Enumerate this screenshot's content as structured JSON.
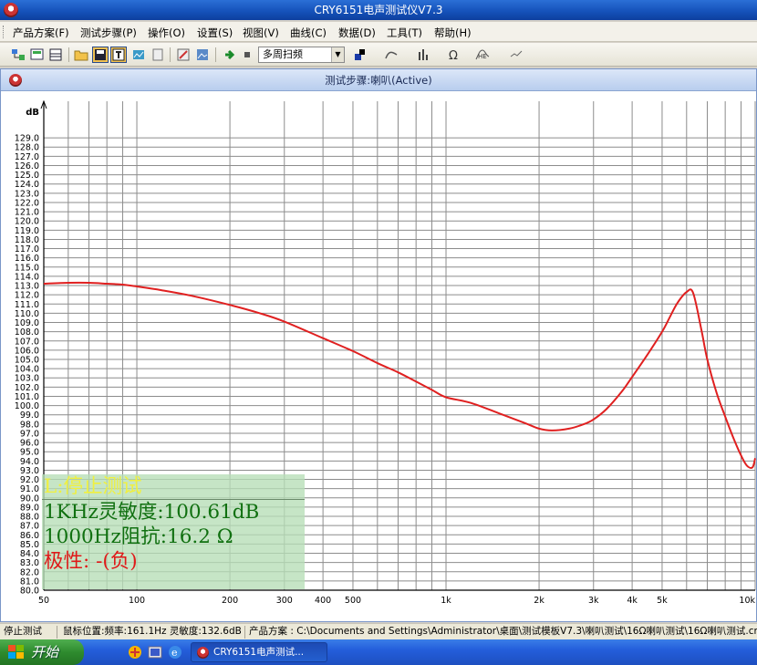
{
  "window": {
    "title": "CRY6151电声测试仪V7.3"
  },
  "menu": [
    "产品方案(F)",
    "测试步骤(P)",
    "操作(O)",
    "设置(S)",
    "视图(V)",
    "曲线(C)",
    "数据(D)",
    "工具(T)",
    "帮助(H)"
  ],
  "toolbar": {
    "sweep_mode": "多周扫频"
  },
  "child_window": {
    "title": "测试步骤:喇叭(Active)"
  },
  "status_bar": {
    "state": "停止测试",
    "cursor": "鼠标位置:频率:161.1Hz 灵敏度:132.6dB",
    "product": "产品方案 : C:\\Documents and Settings\\Administrator\\桌面\\测试模板V7.3\\喇叭测试\\16Ω喇叭测试\\16Ω喇叭测试.cry"
  },
  "taskbar": {
    "start_label": "开始",
    "task_label": "CRY6151电声测试..."
  },
  "overlay": {
    "status": "L:停止测试",
    "sensitivity": "1KHz灵敏度:100.61dB",
    "impedance": "1000Hz阻抗:16.2 Ω",
    "polarity": "极性: -(负)"
  },
  "colors": {
    "curve": "#e02020",
    "status_text": "#f0f040",
    "value_text": "#107010",
    "polarity_text": "#e01818",
    "grid": "#8c8c8c"
  },
  "chart_data": {
    "type": "line",
    "title": "",
    "ylabel": "dB",
    "xlabel": "",
    "x_scale": "log",
    "xlim": [
      50,
      10000
    ],
    "ylim": [
      80,
      130
    ],
    "x_ticks": [
      50,
      100,
      200,
      300,
      400,
      500,
      1000,
      2000,
      3000,
      4000,
      5000,
      10000
    ],
    "x_tick_labels": [
      "50",
      "100",
      "200",
      "300",
      "400",
      "500",
      "1k",
      "2k",
      "3k",
      "4k",
      "5k",
      "10k"
    ],
    "y_ticks": [
      80.0,
      81.0,
      82.0,
      83.0,
      84.0,
      85.0,
      86.0,
      87.0,
      88.0,
      89.0,
      90.0,
      91.0,
      92.0,
      93.0,
      94.0,
      95.0,
      96.0,
      97.0,
      98.0,
      99.0,
      100.0,
      101.0,
      102.0,
      103.0,
      104.0,
      105.0,
      106.0,
      107.0,
      108.0,
      109.0,
      110.0,
      111.0,
      112.0,
      113.0,
      114.0,
      115.0,
      116.0,
      117.0,
      118.0,
      119.0,
      120.0,
      121.0,
      122.0,
      123.0,
      124.0,
      125.0,
      126.0,
      127.0,
      128.0,
      129.0
    ],
    "grid": true,
    "series": [
      {
        "x": [
          50,
          60,
          70,
          80,
          90,
          100,
          120,
          150,
          200,
          250,
          300,
          400,
          500,
          600,
          700,
          800,
          900,
          1000,
          1200,
          1500,
          1800,
          2000,
          2200,
          2500,
          2800,
          3000,
          3300,
          3700,
          4000,
          4500,
          5000,
          5300,
          5600,
          6000,
          6300,
          6700,
          7000,
          7500,
          8000,
          8500,
          9000,
          9400,
          9800,
          10000
        ],
        "y": [
          113.2,
          113.3,
          113.3,
          113.2,
          113.1,
          112.9,
          112.5,
          111.9,
          110.9,
          110.0,
          109.1,
          107.3,
          105.9,
          104.6,
          103.6,
          102.6,
          101.7,
          100.9,
          100.3,
          99.1,
          98.1,
          97.5,
          97.3,
          97.5,
          98.0,
          98.5,
          99.6,
          101.5,
          103.1,
          105.6,
          108.0,
          109.6,
          111.1,
          112.3,
          112.2,
          108.2,
          105.0,
          101.4,
          98.8,
          96.5,
          94.6,
          93.5,
          93.3,
          94.3
        ]
      }
    ]
  }
}
